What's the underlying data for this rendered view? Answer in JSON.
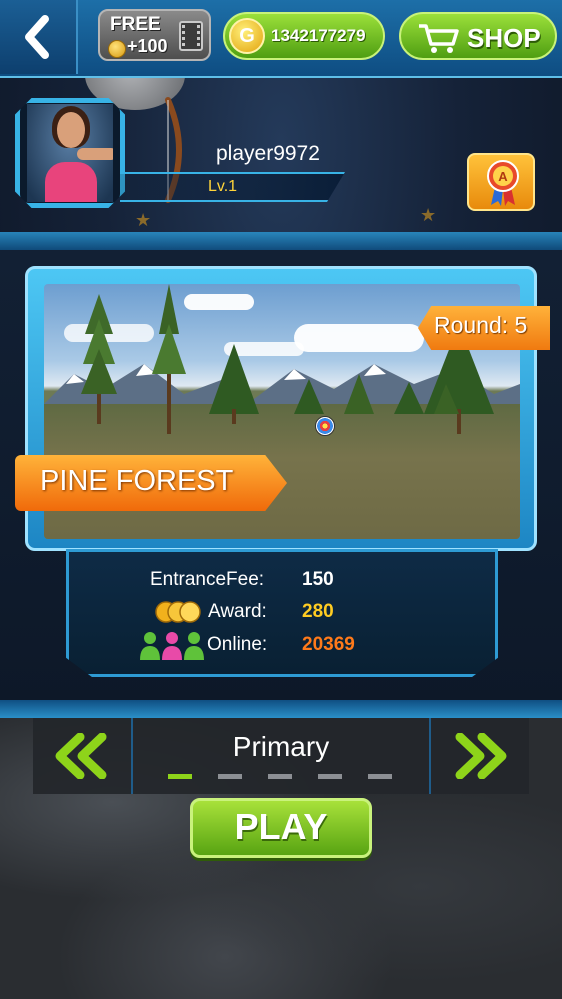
{
  "top_bar": {
    "back_icon": "back-arrow-icon",
    "free_reward": {
      "label": "FREE",
      "amount": "+100",
      "icons": [
        "coin-icon",
        "film-icon"
      ]
    },
    "coins": {
      "value": "1342177279",
      "icon_letter": "G"
    },
    "shop": {
      "label": "SHOP",
      "icon": "cart-icon"
    }
  },
  "profile": {
    "player_name": "player9972",
    "level": "Lv.1",
    "achievement_icon": "medal-icon",
    "achievement_letter": "A"
  },
  "map": {
    "round": "Round: 5",
    "name": "PINE FOREST"
  },
  "stats": {
    "entrance_fee_label": "EntranceFee:",
    "entrance_fee_value": "150",
    "award_label": "Award:",
    "award_value": "280",
    "online_label": "Online:",
    "online_value": "20369"
  },
  "difficulty": {
    "label": "Primary",
    "levels_total": 5,
    "selected_index": 0
  },
  "play_label": "PLAY",
  "colors": {
    "accent_blue": "#2e9bd4",
    "button_green": "#6cc21e",
    "orange": "#f07a10",
    "award_yellow": "#ffcc22",
    "online_orange": "#ff7a1a"
  }
}
